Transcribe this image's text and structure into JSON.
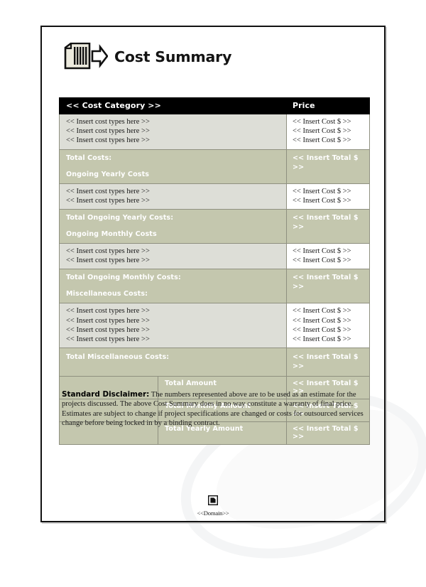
{
  "document": {
    "title": "Cost Summary",
    "title_icon": "document-arrow-icon"
  },
  "table": {
    "headers": {
      "category": "<< Cost Category >>",
      "price": "Price"
    },
    "entry_label": "<< Insert cost types here >>",
    "cost_value": "<< Insert Cost $ >>",
    "total_value": "<< Insert Total $ >>",
    "sections": [
      {
        "type": "entries",
        "rows": [
          {
            "label": "<< Insert cost types here >>",
            "price": "<< Insert Cost $ >>"
          },
          {
            "label": "<< Insert cost types here >>",
            "price": "<< Insert Cost $ >>"
          },
          {
            "label": "<< Insert cost types here >>",
            "price": "<< Insert Cost $ >>"
          }
        ]
      },
      {
        "type": "total",
        "total_label": "Total Costs:",
        "next_section_label": "Ongoing Yearly Costs",
        "price": "<< Insert Total $ >>"
      },
      {
        "type": "entries",
        "rows": [
          {
            "label": "<< Insert cost types here >>",
            "price": "<< Insert Cost $ >>"
          },
          {
            "label": "<< Insert cost types here >>",
            "price": "<< Insert Cost $ >>"
          }
        ]
      },
      {
        "type": "total",
        "total_label": "Total Ongoing Yearly Costs:",
        "next_section_label": "Ongoing Monthly Costs",
        "price": "<< Insert Total $ >>"
      },
      {
        "type": "entries",
        "rows": [
          {
            "label": "<< Insert cost types here >>",
            "price": "<< Insert Cost $ >>"
          },
          {
            "label": "<< Insert cost types here >>",
            "price": "<< Insert Cost $ >>"
          }
        ]
      },
      {
        "type": "total",
        "total_label": "Total Ongoing Monthly Costs:",
        "next_section_label": "Miscellaneous Costs:",
        "price": "<< Insert Total $ >>"
      },
      {
        "type": "entries",
        "rows": [
          {
            "label": "<< Insert cost types here >>",
            "price": "<< Insert Cost $ >>"
          },
          {
            "label": "<< Insert cost types here >>",
            "price": "<< Insert Cost $ >>"
          },
          {
            "label": "<< Insert cost types here >>",
            "price": "<< Insert Cost $ >>"
          },
          {
            "label": "<< Insert cost types here >>",
            "price": "<< Insert Cost $ >>"
          }
        ]
      },
      {
        "type": "total",
        "total_label": "Total Miscellaneous Costs:",
        "next_section_label": "",
        "price": "<< Insert Total $ >>"
      }
    ],
    "grand_totals": [
      {
        "label": "Total Amount",
        "price": "<< Insert Total $ >>"
      },
      {
        "label": "Total Monthly Amount",
        "price": "<< Insert Total $ >>"
      },
      {
        "label": "Total Yearly Amount",
        "price": "<< Insert Total $ >>"
      }
    ]
  },
  "disclaimer": {
    "label": "Standard Disclaimer:",
    "body": " The numbers represented above are to be used as an estimate for the projects discussed. The above Cost Summary does in no way constitute a warranty of final price. Estimates are subject to change if project specifications are changed or costs for outsourced services change before being locked in by a binding contract."
  },
  "footer": {
    "icon": "domain-badge-icon",
    "domain": "<<Domain>>"
  },
  "colors": {
    "header_bg": "#000000",
    "header_fg": "#ffffff",
    "section_green": "#c4c7ae",
    "entry_gray": "#dddeD7",
    "grid_line": "#8f9080",
    "page_border": "#111111"
  }
}
